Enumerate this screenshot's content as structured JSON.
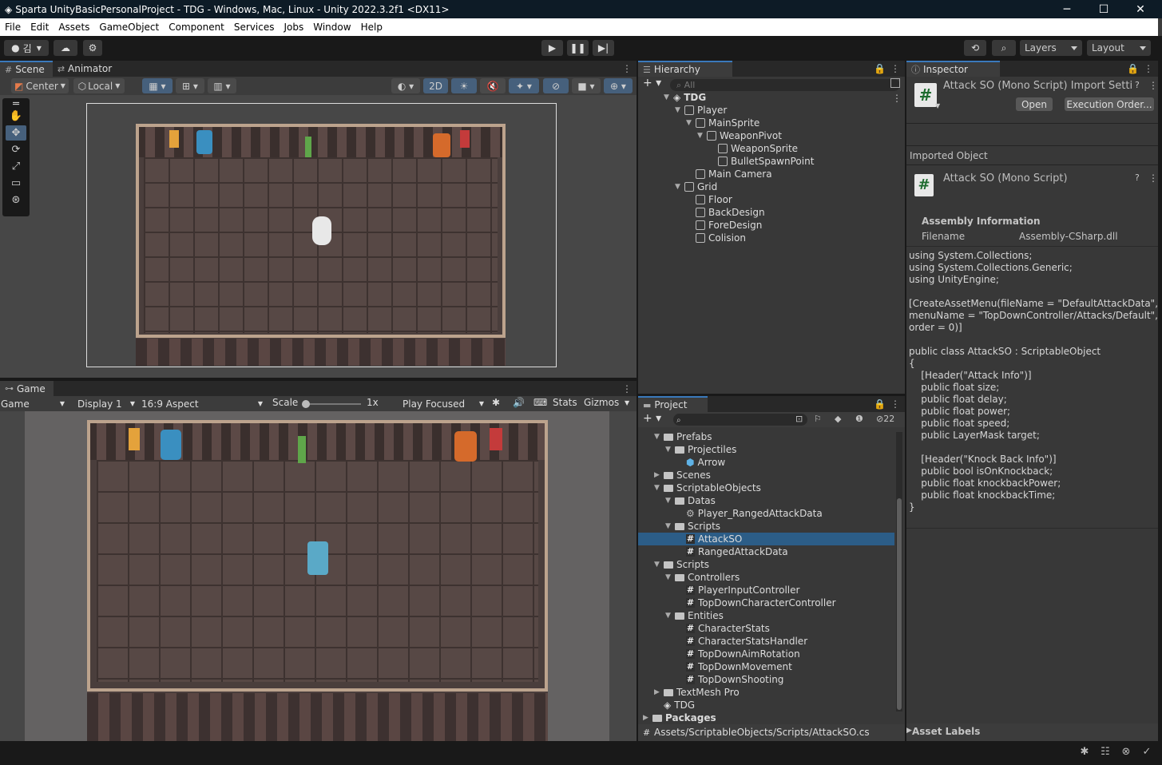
{
  "window": {
    "title": "Sparta UnityBasicPersonalProject - TDG - Windows, Mac, Linux - Unity 2022.3.2f1 <DX11>",
    "controls": [
      "─",
      "☐",
      "✕"
    ]
  },
  "menu": [
    "File",
    "Edit",
    "Assets",
    "GameObject",
    "Component",
    "Services",
    "Jobs",
    "Window",
    "Help"
  ],
  "toolbar": {
    "account": "김",
    "layers": "Layers",
    "layout": "Layout"
  },
  "scene": {
    "tabs": [
      "Scene",
      "Animator"
    ],
    "pivot": "Center",
    "space": "Local",
    "mode_2d": "2D"
  },
  "game": {
    "tab": "Game",
    "mode": "Game",
    "display": "Display 1",
    "aspect": "16:9 Aspect",
    "scale_label": "Scale",
    "scale_value": "1x",
    "play_mode": "Play Focused",
    "stats": "Stats",
    "gizmos": "Gizmos"
  },
  "hierarchy": {
    "tab": "Hierarchy",
    "search_placeholder": "All",
    "items": [
      {
        "label": "TDG",
        "depth": 0,
        "expanded": true,
        "icon": "unity-scene-icon"
      },
      {
        "label": "Player",
        "depth": 1,
        "expanded": true,
        "icon": "gameobject-icon"
      },
      {
        "label": "MainSprite",
        "depth": 2,
        "expanded": true,
        "icon": "gameobject-icon"
      },
      {
        "label": "WeaponPivot",
        "depth": 3,
        "expanded": true,
        "icon": "gameobject-icon"
      },
      {
        "label": "WeaponSprite",
        "depth": 4,
        "icon": "gameobject-icon"
      },
      {
        "label": "BulletSpawnPoint",
        "depth": 4,
        "icon": "gameobject-icon"
      },
      {
        "label": "Main Camera",
        "depth": 2,
        "icon": "gameobject-icon"
      },
      {
        "label": "Grid",
        "depth": 1,
        "expanded": true,
        "icon": "gameobject-icon"
      },
      {
        "label": "Floor",
        "depth": 2,
        "icon": "gameobject-icon"
      },
      {
        "label": "BackDesign",
        "depth": 2,
        "icon": "gameobject-icon"
      },
      {
        "label": "ForeDesign",
        "depth": 2,
        "icon": "gameobject-icon"
      },
      {
        "label": "Colision",
        "depth": 2,
        "icon": "gameobject-icon"
      }
    ]
  },
  "project": {
    "tab": "Project",
    "hidden_count": "22",
    "items": [
      {
        "label": "Prefabs",
        "depth": 1,
        "type": "folder",
        "expanded": true
      },
      {
        "label": "Projectiles",
        "depth": 2,
        "type": "folder",
        "expanded": true
      },
      {
        "label": "Arrow",
        "depth": 3,
        "type": "prefab"
      },
      {
        "label": "Scenes",
        "depth": 1,
        "type": "folder",
        "expanded": false
      },
      {
        "label": "ScriptableObjects",
        "depth": 1,
        "type": "folder",
        "expanded": true
      },
      {
        "label": "Datas",
        "depth": 2,
        "type": "folder",
        "expanded": true
      },
      {
        "label": "Player_RangedAttackData",
        "depth": 3,
        "type": "asset"
      },
      {
        "label": "Scripts",
        "depth": 2,
        "type": "folder",
        "expanded": true
      },
      {
        "label": "AttackSO",
        "depth": 3,
        "type": "script",
        "selected": true
      },
      {
        "label": "RangedAttackData",
        "depth": 3,
        "type": "script"
      },
      {
        "label": "Scripts",
        "depth": 1,
        "type": "folder",
        "expanded": true
      },
      {
        "label": "Controllers",
        "depth": 2,
        "type": "folder",
        "expanded": true
      },
      {
        "label": "PlayerInputController",
        "depth": 3,
        "type": "script"
      },
      {
        "label": "TopDownCharacterController",
        "depth": 3,
        "type": "script"
      },
      {
        "label": "Entities",
        "depth": 2,
        "type": "folder",
        "expanded": true
      },
      {
        "label": "CharacterStats",
        "depth": 3,
        "type": "script"
      },
      {
        "label": "CharacterStatsHandler",
        "depth": 3,
        "type": "script"
      },
      {
        "label": "TopDownAimRotation",
        "depth": 3,
        "type": "script"
      },
      {
        "label": "TopDownMovement",
        "depth": 3,
        "type": "script"
      },
      {
        "label": "TopDownShooting",
        "depth": 3,
        "type": "script"
      },
      {
        "label": "TextMesh Pro",
        "depth": 1,
        "type": "folder",
        "expanded": false
      },
      {
        "label": "TDG",
        "depth": 1,
        "type": "scene"
      },
      {
        "label": "Packages",
        "depth": 0,
        "type": "folder",
        "expanded": false,
        "bold": true
      }
    ],
    "path": "Assets/ScriptableObjects/Scripts/AttackSO.cs"
  },
  "inspector": {
    "tab": "Inspector",
    "title": "Attack SO (Mono Script) Import Setti",
    "open_button": "Open",
    "execution_order_button": "Execution Order...",
    "imported_object_label": "Imported Object",
    "object_title": "Attack SO (Mono Script)",
    "assembly_header": "Assembly Information",
    "filename_label": "Filename",
    "filename_value": "Assembly-CSharp.dll",
    "code": "using System.Collections;\nusing System.Collections.Generic;\nusing UnityEngine;\n\n[CreateAssetMenu(fileName = \"DefaultAttackData\",\nmenuName = \"TopDownController/Attacks/Default\",\norder = 0)]\n\npublic class AttackSO : ScriptableObject\n{\n    [Header(\"Attack Info\")]\n    public float size;\n    public float delay;\n    public float power;\n    public float speed;\n    public LayerMask target;\n\n    [Header(\"Knock Back Info\")]\n    public bool isOnKnockback;\n    public float knockbackPower;\n    public float knockbackTime;\n}",
    "asset_labels": "Asset Labels"
  },
  "colors": {
    "selection": "#2c5d87",
    "accent_tab": "#3a79bb",
    "panel_bg": "#383838"
  }
}
